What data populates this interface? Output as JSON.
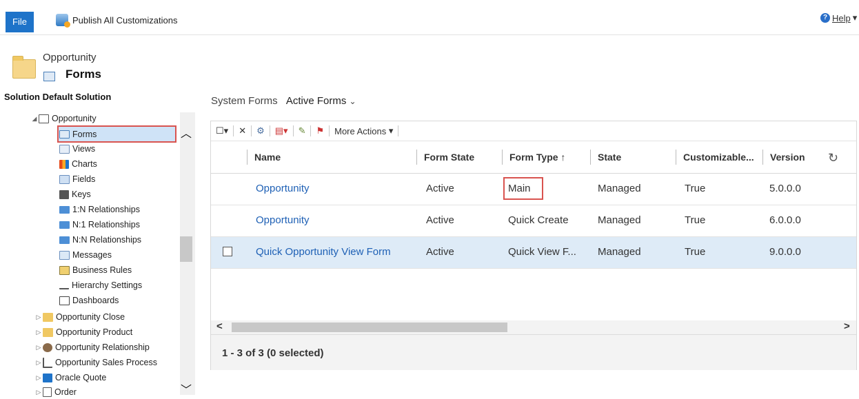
{
  "topbar": {
    "file_label": "File",
    "publish_label": "Publish All Customizations",
    "help_label": "Help"
  },
  "header": {
    "entity": "Opportunity",
    "section": "Forms"
  },
  "sidebar": {
    "solution_title": "Solution Default Solution",
    "root": "Opportunity",
    "items": [
      "Forms",
      "Views",
      "Charts",
      "Fields",
      "Keys",
      "1:N Relationships",
      "N:1 Relationships",
      "N:N Relationships",
      "Messages",
      "Business Rules",
      "Hierarchy Settings",
      "Dashboards"
    ],
    "siblings": [
      "Opportunity Close",
      "Opportunity Product",
      "Opportunity Relationship",
      "Opportunity Sales Process",
      "Oracle Quote",
      "Order"
    ]
  },
  "view": {
    "label": "System Forms",
    "name": "Active Forms"
  },
  "toolbar": {
    "more_actions": "More Actions"
  },
  "table": {
    "columns": [
      "Name",
      "Form State",
      "Form Type",
      "State",
      "Customizable...",
      "Version"
    ],
    "rows": [
      {
        "name": "Opportunity",
        "form_state": "Active",
        "form_type": "Main",
        "state": "Managed",
        "customizable": "True",
        "version": "5.0.0.0"
      },
      {
        "name": "Opportunity",
        "form_state": "Active",
        "form_type": "Quick Create",
        "state": "Managed",
        "customizable": "True",
        "version": "6.0.0.0"
      },
      {
        "name": "Quick Opportunity View Form",
        "form_state": "Active",
        "form_type": "Quick View F...",
        "state": "Managed",
        "customizable": "True",
        "version": "9.0.0.0"
      }
    ],
    "footer": "1 - 3 of 3 (0 selected)",
    "sort_icon": "arrow-up-icon"
  },
  "colors": {
    "accent": "#1e73c9",
    "link": "#1e60b5",
    "highlight": "#d9534f",
    "selected_row": "#deebf7"
  }
}
